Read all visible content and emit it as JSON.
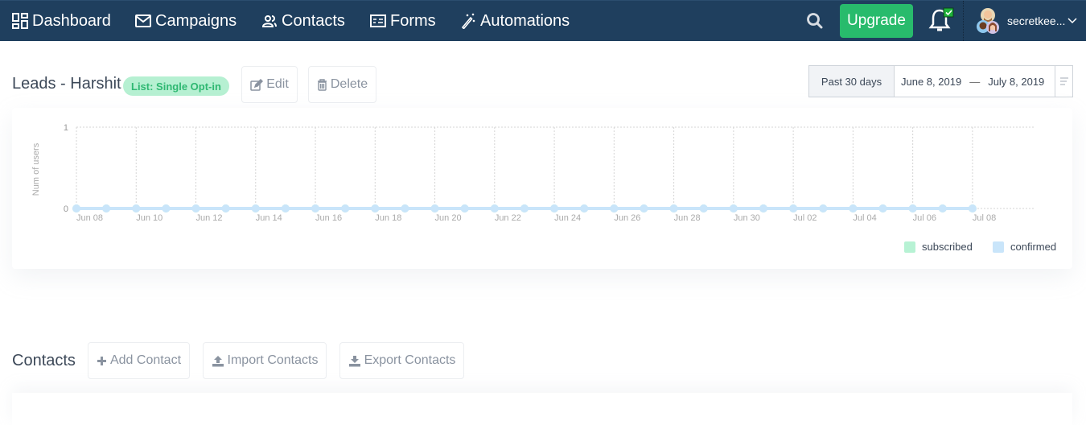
{
  "nav": {
    "items": [
      {
        "label": "Dashboard",
        "icon": "dashboard-icon"
      },
      {
        "label": "Campaigns",
        "icon": "envelope-icon"
      },
      {
        "label": "Contacts",
        "icon": "users-icon"
      },
      {
        "label": "Forms",
        "icon": "form-icon"
      },
      {
        "label": "Automations",
        "icon": "magic-wand-icon"
      }
    ],
    "upgrade_label": "Upgrade",
    "username": "secretkee...",
    "colors": {
      "bar": "#1f3f5e",
      "upgrade": "#28bb6c",
      "notification_badge": "#1fb33a"
    }
  },
  "list": {
    "title": "Leads - Harshit",
    "badge": "List: Single Opt-in",
    "edit_label": "Edit",
    "delete_label": "Delete"
  },
  "daterange": {
    "preset": "Past 30 days",
    "start": "June 8, 2019",
    "separator": "—",
    "end": "July 8, 2019"
  },
  "chart_data": {
    "type": "line",
    "title": "",
    "xlabel": "",
    "ylabel": "Num of users",
    "ylim": [
      0,
      1
    ],
    "yticks": [
      "0",
      "1"
    ],
    "grid": true,
    "legend_position": "bottom-right",
    "x": [
      "Jun 08",
      "Jun 09",
      "Jun 10",
      "Jun 11",
      "Jun 12",
      "Jun 13",
      "Jun 14",
      "Jun 15",
      "Jun 16",
      "Jun 17",
      "Jun 18",
      "Jun 19",
      "Jun 20",
      "Jun 21",
      "Jun 22",
      "Jun 23",
      "Jun 24",
      "Jun 25",
      "Jun 26",
      "Jun 27",
      "Jun 28",
      "Jun 29",
      "Jun 30",
      "Jul 01",
      "Jul 02",
      "Jul 03",
      "Jul 04",
      "Jul 05",
      "Jul 06",
      "Jul 07",
      "Jul 08"
    ],
    "xtick_labels": [
      "Jun 08",
      "Jun 10",
      "Jun 12",
      "Jun 14",
      "Jun 16",
      "Jun 18",
      "Jun 20",
      "Jun 22",
      "Jun 24",
      "Jun 26",
      "Jun 28",
      "Jun 30",
      "Jul 02",
      "Jul 04",
      "Jul 06",
      "Jul 08"
    ],
    "series": [
      {
        "name": "subscribed",
        "color": "#b7f2d4",
        "values": [
          0,
          0,
          0,
          0,
          0,
          0,
          0,
          0,
          0,
          0,
          0,
          0,
          0,
          0,
          0,
          0,
          0,
          0,
          0,
          0,
          0,
          0,
          0,
          0,
          0,
          0,
          0,
          0,
          0,
          0,
          0
        ]
      },
      {
        "name": "confirmed",
        "color": "#c9e5fa",
        "values": [
          0,
          0,
          0,
          0,
          0,
          0,
          0,
          0,
          0,
          0,
          0,
          0,
          0,
          0,
          0,
          0,
          0,
          0,
          0,
          0,
          0,
          0,
          0,
          0,
          0,
          0,
          0,
          0,
          0,
          0,
          0
        ]
      }
    ]
  },
  "contacts": {
    "title": "Contacts",
    "add_label": "Add Contact",
    "import_label": "Import Contacts",
    "export_label": "Export Contacts"
  }
}
